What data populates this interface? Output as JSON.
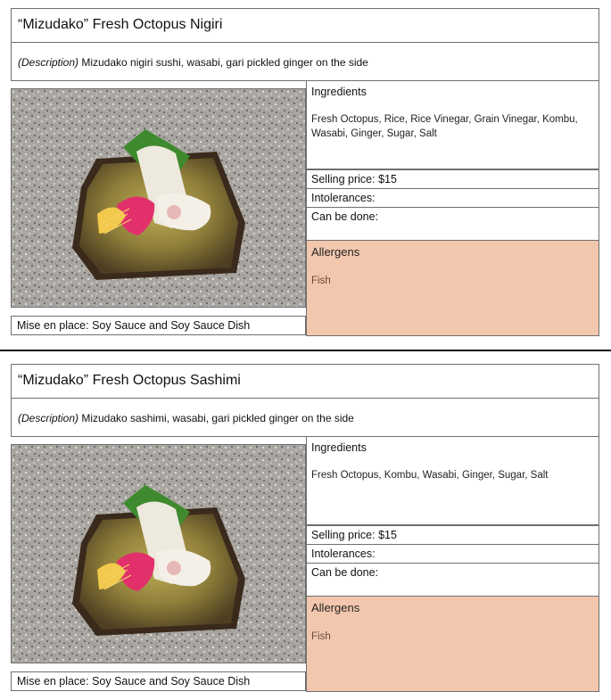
{
  "cards": [
    {
      "title": "“Mizudako” Fresh Octopus Nigiri",
      "description_label": "(Description)",
      "description": " Mizudako nigiri sushi, wasabi, gari pickled ginger on the side",
      "ingredients_label": "Ingredients",
      "ingredients": "Fresh Octopus, Rice, Rice Vinegar, Grain Vinegar, Kombu, Wasabi, Ginger, Sugar, Salt",
      "selling_price_label": "Selling price:",
      "selling_price": "$15",
      "intolerances_label": "Intolerances:",
      "can_be_done_label": "Can be done:",
      "allergens_label": "Allergens",
      "allergens": "Fish",
      "mise_en_place": "Mise en place: Soy Sauce and Soy Sauce Dish"
    },
    {
      "title": "“Mizudako” Fresh Octopus Sashimi",
      "description_label": "(Description)",
      "description": " Mizudako sashimi, wasabi, gari pickled ginger on the side",
      "ingredients_label": "Ingredients",
      "ingredients": "Fresh Octopus, Kombu, Wasabi, Ginger, Sugar, Salt",
      "selling_price_label": "Selling price:",
      "selling_price": "$15",
      "intolerances_label": "Intolerances:",
      "can_be_done_label": "Can be done:",
      "allergens_label": "Allergens",
      "allergens": "Fish",
      "mise_en_place": "Mise en place: Soy Sauce and Soy Sauce Dish"
    }
  ],
  "colors": {
    "allergen_bg": "#f3c7ad",
    "border": "#6f6f6f",
    "divider": "#111111"
  }
}
